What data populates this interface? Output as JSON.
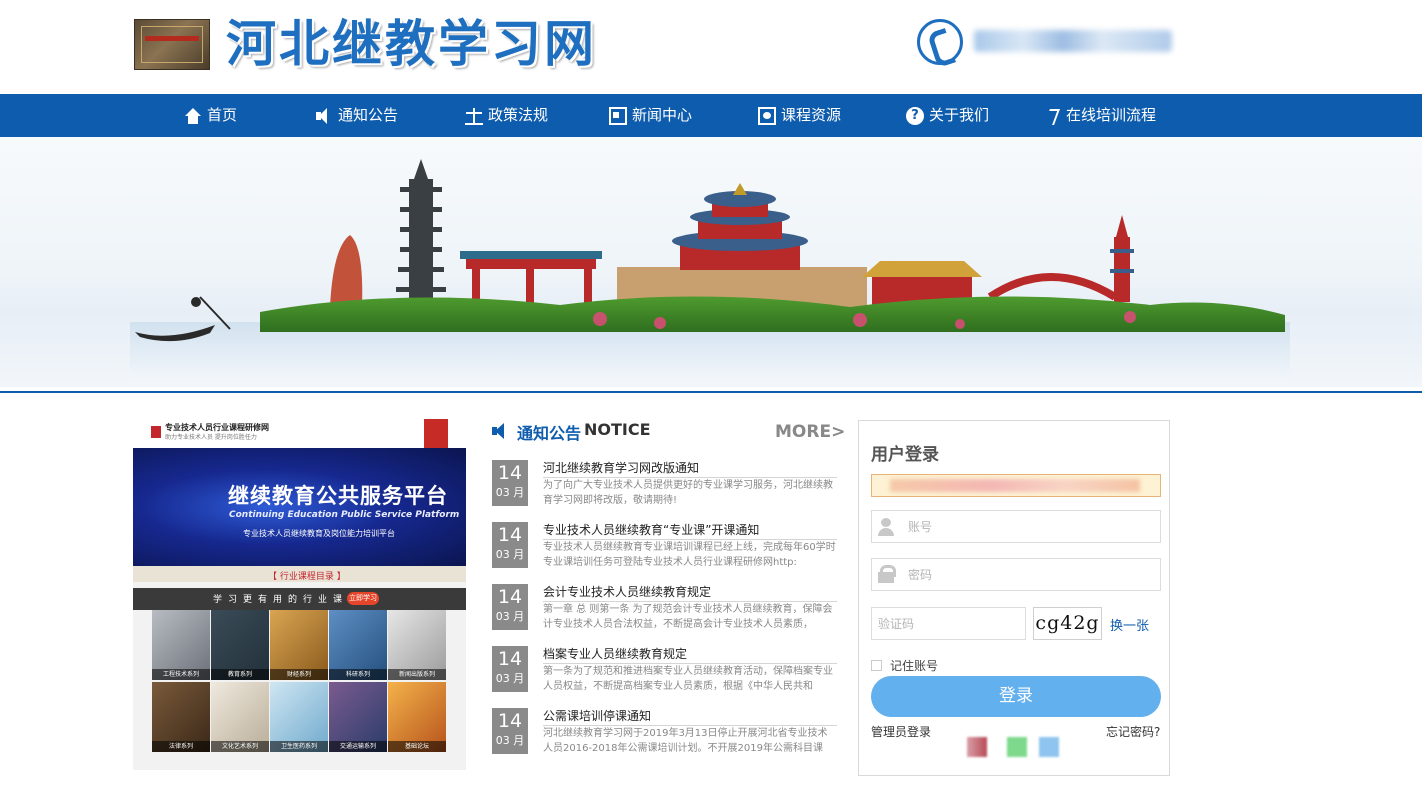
{
  "header": {
    "site_title": "河北继教学习网"
  },
  "nav": {
    "items": [
      {
        "label": "首页",
        "icon": "home-icon"
      },
      {
        "label": "通知公告",
        "icon": "speaker-icon"
      },
      {
        "label": "政策法规",
        "icon": "scale-icon"
      },
      {
        "label": "新闻中心",
        "icon": "newspaper-icon"
      },
      {
        "label": "课程资源",
        "icon": "course-icon"
      },
      {
        "label": "关于我们",
        "icon": "help-icon"
      },
      {
        "label": "在线培训流程",
        "icon": "flow-icon"
      }
    ]
  },
  "promo": {
    "head_title": "专业技术人员行业课程研修网",
    "head_sub": "助力专业技术人员 提升岗位胜任力",
    "hero_title": "继续教育公共服务平台",
    "hero_en": "Continuing Education Public Service Platform",
    "hero_sub": "专业技术人员继续教育及岗位能力培训平台",
    "catalog_label": "【 行业课程目录 】",
    "bar_text": "学习更有用的行业课程",
    "bar_button": "立即学习",
    "tiles": [
      {
        "caption": "工程技术系列"
      },
      {
        "caption": "教育系列"
      },
      {
        "caption": "财经系列"
      },
      {
        "caption": "科研系列"
      },
      {
        "caption": "新闻出版系列"
      },
      {
        "caption": "法律系列"
      },
      {
        "caption": "文化艺术系列"
      },
      {
        "caption": "卫生医药系列"
      },
      {
        "caption": "交通运输系列"
      },
      {
        "caption": "基础论坛"
      }
    ]
  },
  "notices": {
    "title": "通知公告",
    "title_en": "NOTICE",
    "more_label": "MORE>",
    "items": [
      {
        "day": "14",
        "month": "03 月",
        "title": "河北继续教育学习网改版通知",
        "desc": "为了向广大专业技术人员提供更好的专业课学习服务，河北继续教育学习网即将改版，敬请期待!"
      },
      {
        "day": "14",
        "month": "03 月",
        "title": "专业技术人员继续教育“专业课”开课通知",
        "desc": "专业技术人员继续教育专业课培训课程已经上线，完成每年60学时专业课培训任务可登陆专业技术人员行业课程研修网http:"
      },
      {
        "day": "14",
        "month": "03 月",
        "title": "会计专业技术人员继续教育规定",
        "desc": "第一章 总 则第一条 为了规范会计专业技术人员继续教育，保障会计专业技术人员合法权益，不断提高会计专业技术人员素质，"
      },
      {
        "day": "14",
        "month": "03 月",
        "title": "档案专业人员继续教育规定",
        "desc": "第一条为了规范和推进档案专业人员继续教育活动，保障档案专业人员权益，不断提高档案专业人员素质，根据《中华人民共和"
      },
      {
        "day": "14",
        "month": "03 月",
        "title": "公需课培训停课通知",
        "desc": "河北继续教育学习网于2019年3月13日停止开展河北省专业技术人员2016-2018年公需课培训计划。不开展2019年公需科目课"
      }
    ]
  },
  "login": {
    "title": "用户登录",
    "account_placeholder": "账号",
    "password_placeholder": "密码",
    "captcha_placeholder": "验证码",
    "captcha_text": "cg42g",
    "refresh_label": "换一张",
    "remember_label": "记住账号",
    "submit_label": "登录",
    "admin_label": "管理员登录",
    "forgot_label": "忘记密码?"
  },
  "colors": {
    "brand_blue": "#0e5cae",
    "title_blue": "#1f6fc0",
    "login_button": "#63b0ee",
    "date_box": "#8a8a8a"
  }
}
